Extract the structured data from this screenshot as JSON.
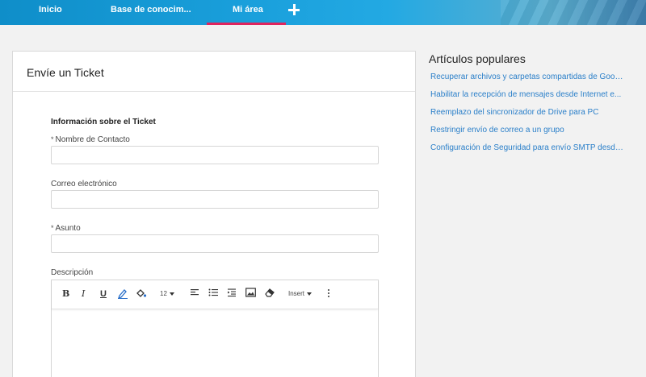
{
  "nav": {
    "items": [
      {
        "label": "Inicio"
      },
      {
        "label": "Base de conocim..."
      },
      {
        "label": "Mi área"
      }
    ],
    "active": "Mi área",
    "add_icon": "plus-icon",
    "accent_color": "#e0245e"
  },
  "ticket_form": {
    "title": "Envíe un Ticket",
    "section_title": "Información sobre el Ticket",
    "fields": {
      "contact_name": {
        "label": "Nombre de Contacto",
        "required_mark": "*",
        "value": ""
      },
      "email": {
        "label": "Correo electrónico",
        "value": ""
      },
      "subject": {
        "label": "Asunto",
        "required_mark": "*",
        "value": ""
      },
      "description": {
        "label": "Descripción"
      }
    },
    "editor_toolbar": {
      "bold": "B",
      "italic": "I",
      "underline": "U",
      "font_size": "12",
      "insert": "Insert",
      "icons": [
        "pen-icon",
        "paint-bucket-icon",
        "align-left-icon",
        "bullet-list-icon",
        "indent-icon",
        "image-icon",
        "eraser-icon",
        "more-vertical-icon"
      ]
    }
  },
  "popular": {
    "title": "Artículos populares",
    "articles": [
      "Recuperar archivos y carpetas compartidas de Goog...",
      "Habilitar la recepción de mensajes desde Internet e...",
      "Reemplazo del sincronizador de Drive para PC",
      "Restringir envío de correo a un grupo",
      "Configuración de Seguridad para envío SMTP desde..."
    ],
    "link_color": "#2a7fc9"
  }
}
